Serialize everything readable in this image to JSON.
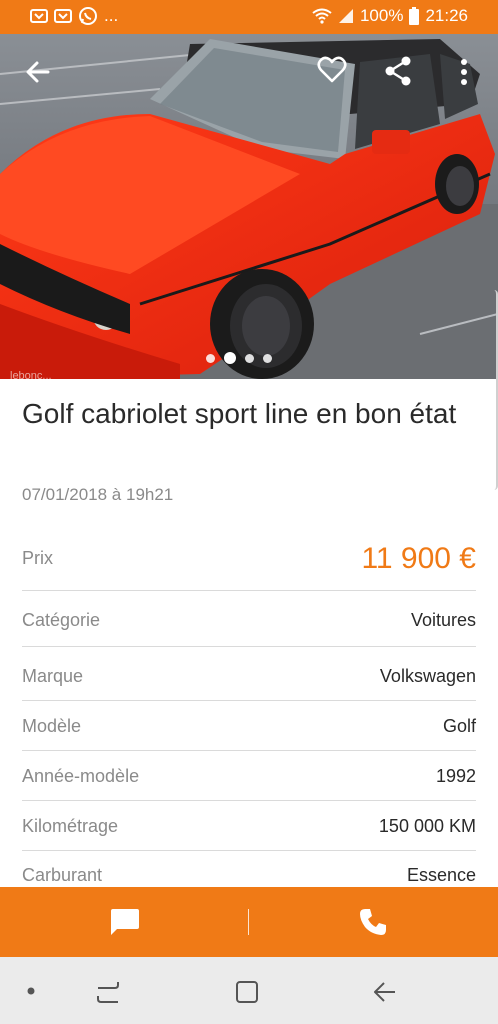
{
  "status_bar": {
    "battery": "100%",
    "time": "21:26",
    "more": "..."
  },
  "hero": {
    "watermark": "lebonc...",
    "photo_count": 4,
    "active_photo_index": 1
  },
  "listing": {
    "title": "Golf cabriolet sport line en bon état",
    "date": "07/01/2018 à 19h21"
  },
  "details": {
    "price_label": "Prix",
    "price": "11 900 €",
    "rows": [
      {
        "label": "Catégorie",
        "value": "Voitures"
      },
      {
        "label": "Marque",
        "value": "Volkswagen"
      },
      {
        "label": "Modèle",
        "value": "Golf"
      },
      {
        "label": "Année-modèle",
        "value": "1992"
      },
      {
        "label": "Kilométrage",
        "value": "150 000 KM"
      },
      {
        "label": "Carburant",
        "value": "Essence"
      }
    ]
  },
  "colors": {
    "accent": "#f07a16",
    "text": "#2a2a2a",
    "muted": "#8a8a8a",
    "nav_bg": "#ebebeb"
  },
  "icons": {
    "back": "arrow-left-icon",
    "favorite": "heart-icon",
    "share": "share-icon",
    "more": "more-vertical-icon",
    "message": "chat-icon",
    "call": "phone-icon"
  }
}
